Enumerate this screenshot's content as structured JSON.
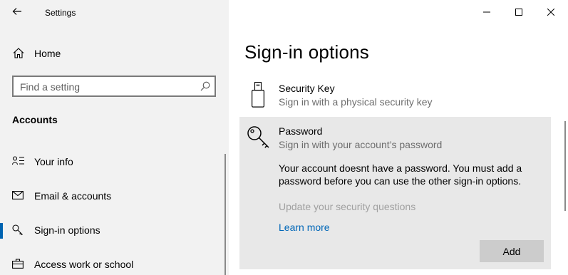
{
  "window": {
    "title": "Settings",
    "controls": {
      "minimize": "minimize-icon",
      "maximize": "maximize-icon",
      "close": "close-icon"
    }
  },
  "sidebar": {
    "home_label": "Home",
    "search": {
      "placeholder": "Find a setting",
      "value": ""
    },
    "section_heading": "Accounts",
    "items": [
      {
        "label": "Your info",
        "icon": "person-list-icon",
        "selected": false
      },
      {
        "label": "Email & accounts",
        "icon": "mail-icon",
        "selected": false
      },
      {
        "label": "Sign-in options",
        "icon": "key-icon",
        "selected": true
      },
      {
        "label": "Access work or school",
        "icon": "briefcase-icon",
        "selected": false
      }
    ]
  },
  "main": {
    "page_title": "Sign-in options",
    "security_key": {
      "title": "Security Key",
      "subtitle": "Sign in with a physical security key"
    },
    "password": {
      "title": "Password",
      "subtitle": "Sign in with your account’s password",
      "message": "Your account doesnt have a password. You must add a password before you can use the other sign-in options.",
      "update_link": "Update your security questions",
      "learn_link": "Learn more",
      "add_button": "Add"
    }
  },
  "colors": {
    "accent": "#0063b1",
    "link": "#0067b8",
    "sidebar_bg": "#f2f2f2",
    "selected_card_bg": "#e8e8e8"
  }
}
